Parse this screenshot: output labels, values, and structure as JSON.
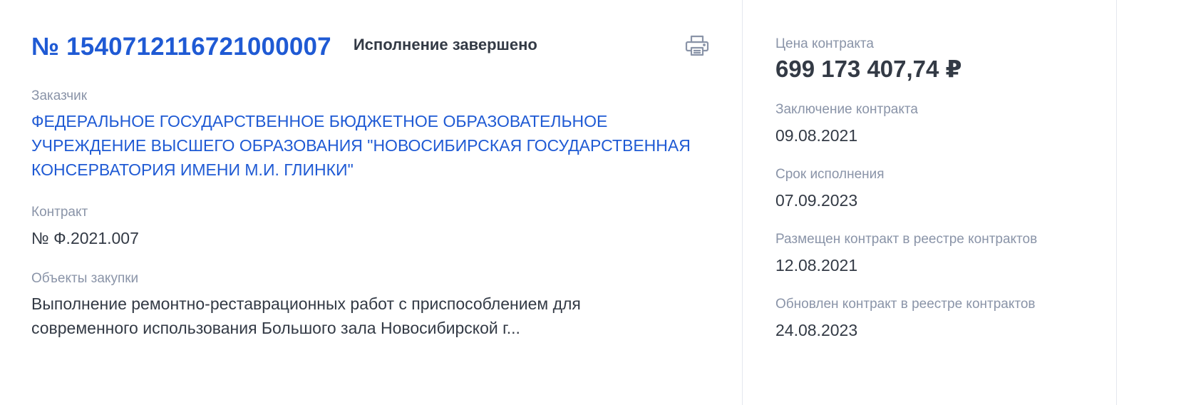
{
  "header": {
    "contract_number": "№ 1540712116721000007",
    "status": "Исполнение завершено"
  },
  "customer": {
    "label": "Заказчик",
    "name": "ФЕДЕРАЛЬНОЕ ГОСУДАРСТВЕННОЕ БЮДЖЕТНОЕ ОБРАЗОВАТЕЛЬНОЕ УЧРЕЖДЕНИЕ ВЫСШЕГО ОБРАЗОВАНИЯ \"НОВОСИБИРСКАЯ ГОСУДАРСТВЕННАЯ КОНСЕРВАТОРИЯ ИМЕНИ М.И. ГЛИНКИ\""
  },
  "contract": {
    "label": "Контракт",
    "value": "№ Ф.2021.007"
  },
  "objects": {
    "label": "Объекты закупки",
    "value": "Выполнение ремонтно-реставрационных работ с приспособлением для современного использования Большого зала Новосибирской г..."
  },
  "side": {
    "price_label": "Цена контракта",
    "price_value": "699 173 407,74 ₽",
    "conclusion_label": "Заключение контракта",
    "conclusion_value": "09.08.2021",
    "deadline_label": "Срок исполнения",
    "deadline_value": "07.09.2023",
    "placed_label": "Размещен контракт в реестре контрактов",
    "placed_value": "12.08.2021",
    "updated_label": "Обновлен контракт в реестре контрактов",
    "updated_value": "24.08.2023"
  },
  "icons": {
    "print": "print-icon"
  },
  "colors": {
    "link": "#1f5ad4",
    "text": "#333a45",
    "label": "#8a94a8",
    "border": "#e4e7ee"
  }
}
